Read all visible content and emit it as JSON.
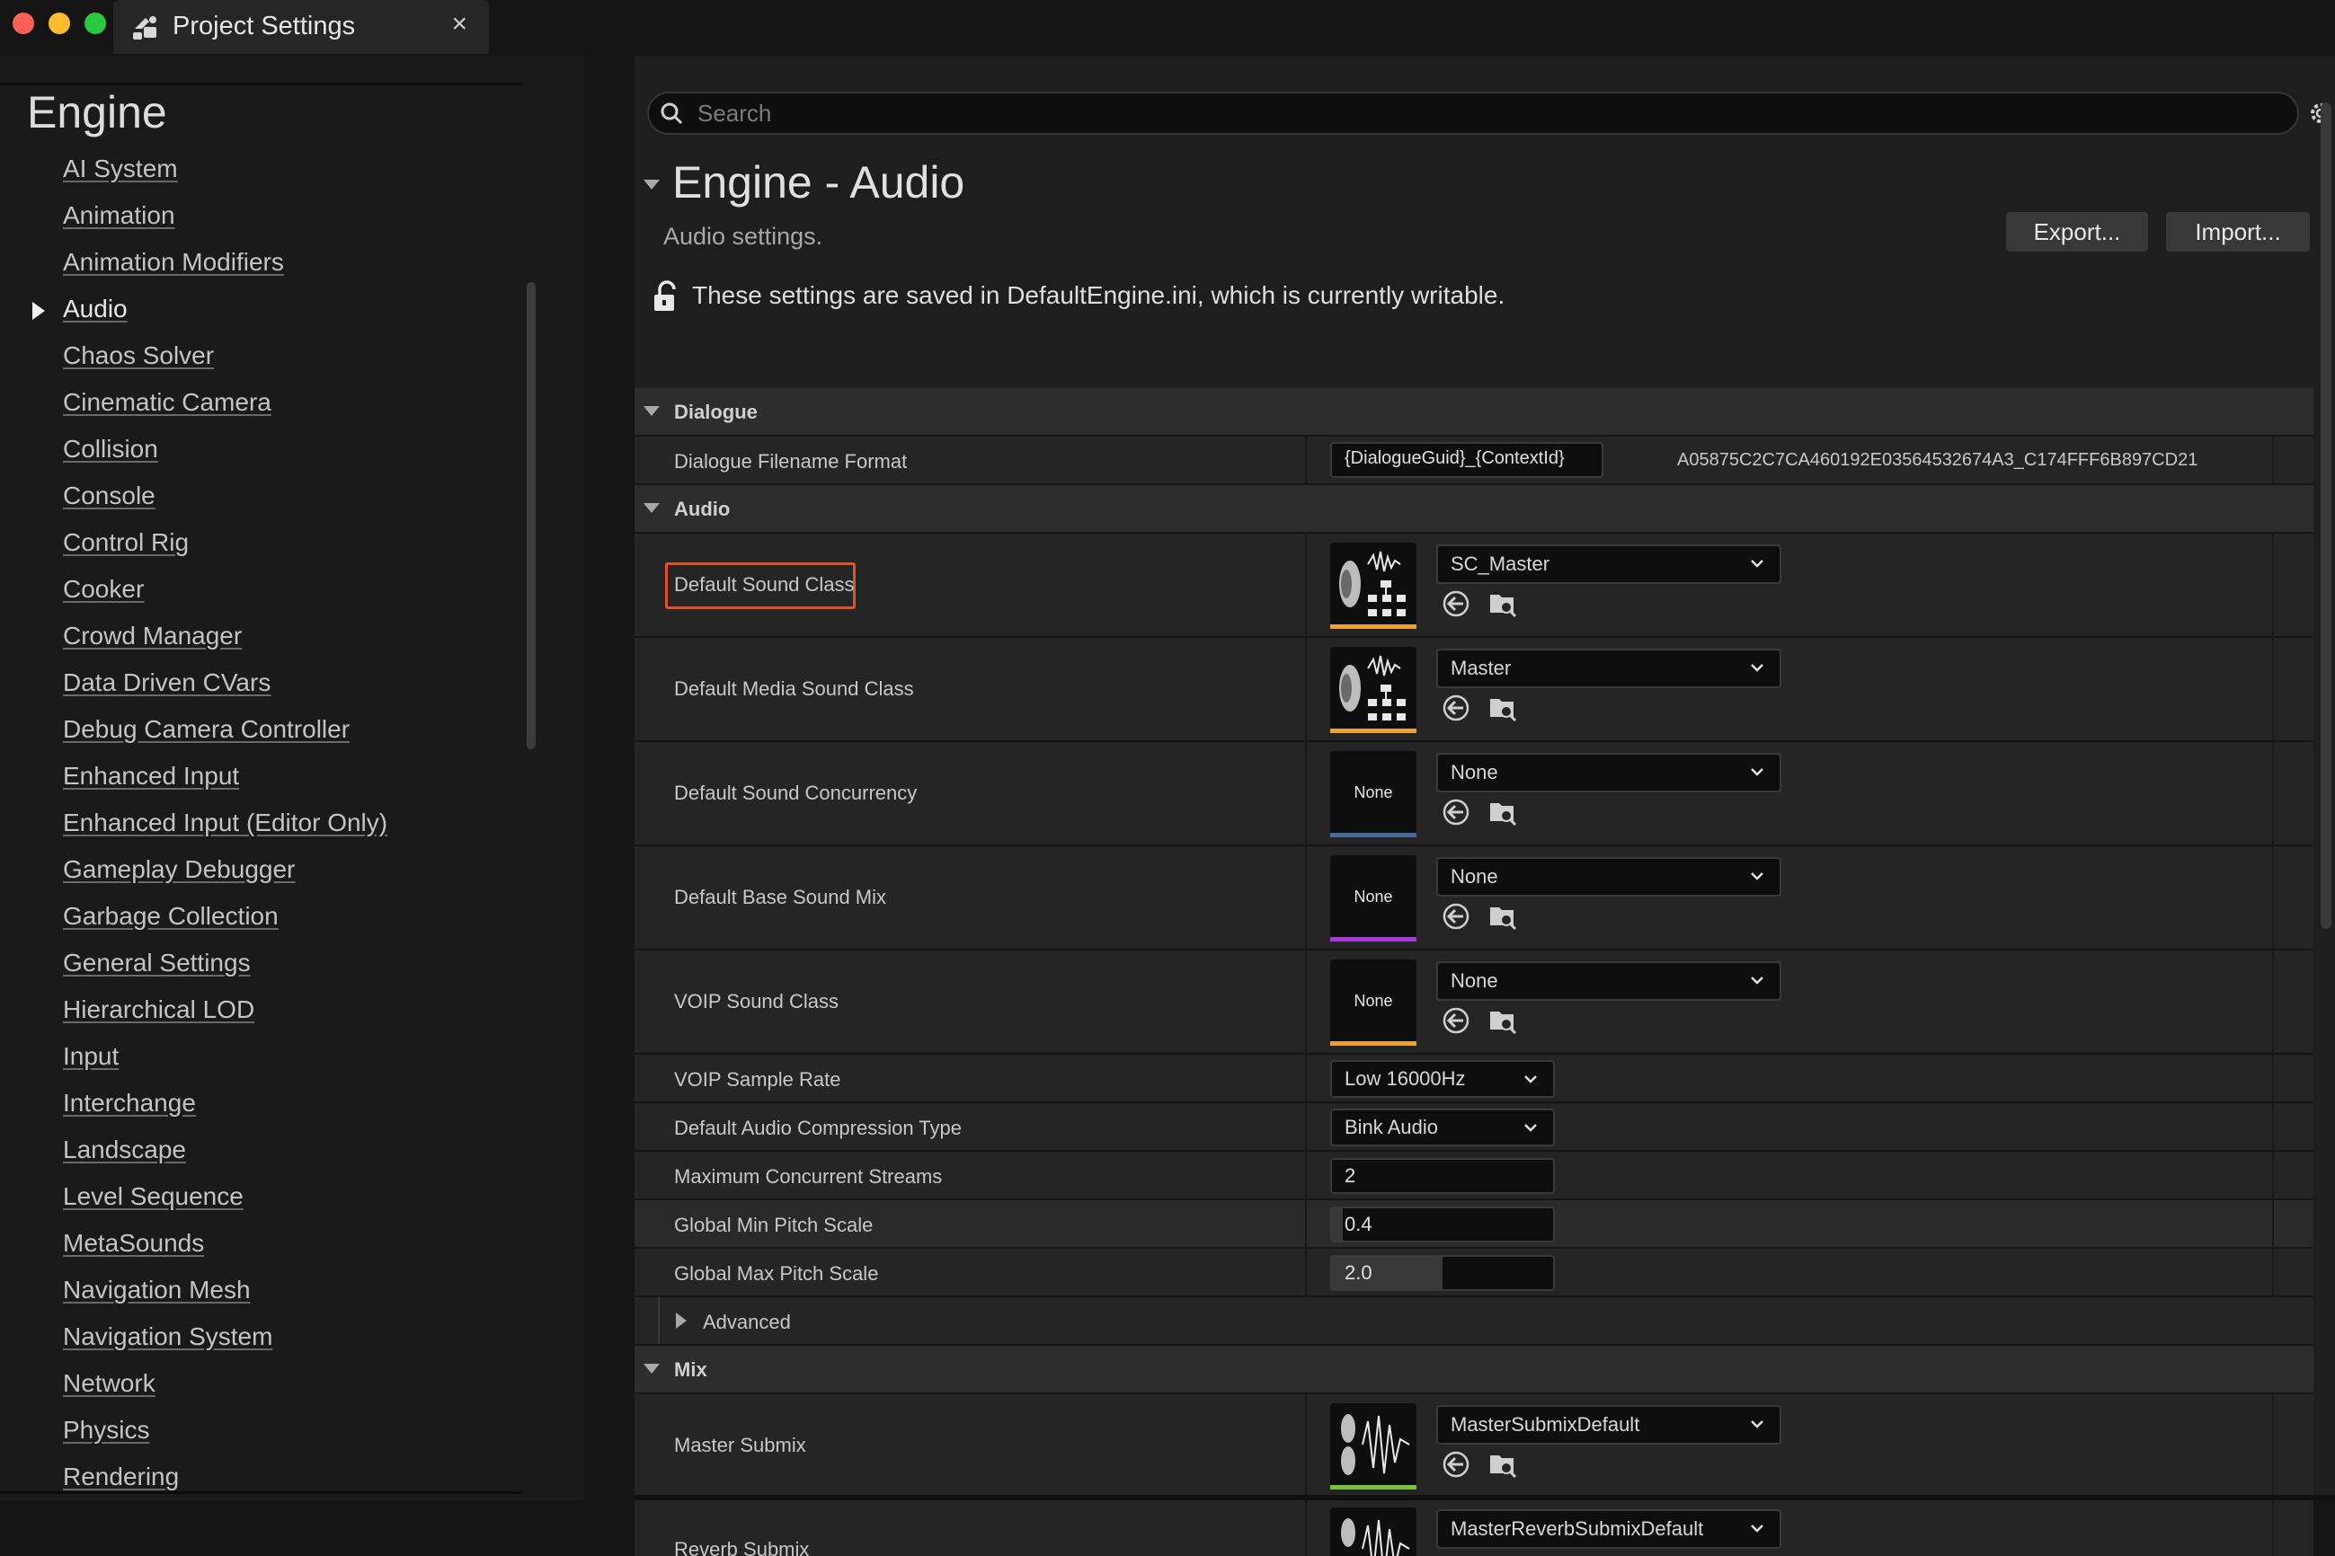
{
  "window": {
    "tab_title": "Project Settings",
    "close_glyph": "×",
    "colors": {
      "close": "#fe5f57",
      "minimize": "#febc2e",
      "maximize": "#28c840"
    }
  },
  "sidebar": {
    "title": "Engine",
    "items": [
      {
        "label": "AI System"
      },
      {
        "label": "Animation"
      },
      {
        "label": "Animation Modifiers"
      },
      {
        "label": "Audio",
        "selected": true
      },
      {
        "label": "Chaos Solver"
      },
      {
        "label": "Cinematic Camera"
      },
      {
        "label": "Collision"
      },
      {
        "label": "Console"
      },
      {
        "label": "Control Rig"
      },
      {
        "label": "Cooker"
      },
      {
        "label": "Crowd Manager"
      },
      {
        "label": "Data Driven CVars"
      },
      {
        "label": "Debug Camera Controller"
      },
      {
        "label": "Enhanced Input"
      },
      {
        "label": "Enhanced Input (Editor Only)"
      },
      {
        "label": "Gameplay Debugger"
      },
      {
        "label": "Garbage Collection"
      },
      {
        "label": "General Settings"
      },
      {
        "label": "Hierarchical LOD"
      },
      {
        "label": "Input"
      },
      {
        "label": "Interchange"
      },
      {
        "label": "Landscape"
      },
      {
        "label": "Level Sequence"
      },
      {
        "label": "MetaSounds"
      },
      {
        "label": "Navigation Mesh"
      },
      {
        "label": "Navigation System"
      },
      {
        "label": "Network"
      },
      {
        "label": "Physics"
      },
      {
        "label": "Rendering"
      }
    ]
  },
  "search": {
    "placeholder": "Search"
  },
  "page": {
    "title": "Engine - Audio",
    "subtitle": "Audio settings.",
    "export_label": "Export...",
    "import_label": "Import...",
    "saved_note": "These settings are saved in DefaultEngine.ini, which is currently writable."
  },
  "sections": {
    "dialogue": {
      "label": "Dialogue",
      "filename_format_label": "Dialogue Filename Format",
      "filename_format_value": "{DialogueGuid}_{ContextId}",
      "guid": "A05875C2C7CA460192E03564532674A3_C174FFF6B897CD21"
    },
    "audio": {
      "label": "Audio",
      "default_sound_class": {
        "label": "Default Sound Class",
        "value": "SC_Master",
        "thumb_color": "#e8a530"
      },
      "default_media_sound_class": {
        "label": "Default Media Sound Class",
        "value": "Master",
        "thumb_color": "#e8a530"
      },
      "default_sound_concurrency": {
        "label": "Default Sound Concurrency",
        "value": "None",
        "thumb_text": "None",
        "thumb_color": "#4a6a9a"
      },
      "default_base_sound_mix": {
        "label": "Default Base Sound Mix",
        "value": "None",
        "thumb_text": "None",
        "thumb_color": "#a83ad8"
      },
      "voip_sound_class": {
        "label": "VOIP Sound Class",
        "value": "None",
        "thumb_text": "None",
        "thumb_color": "#e8a530"
      },
      "voip_sample_rate": {
        "label": "VOIP Sample Rate",
        "value": "Low 16000Hz"
      },
      "compression_type": {
        "label": "Default Audio Compression Type",
        "value": "Bink Audio"
      },
      "max_streams": {
        "label": "Maximum Concurrent Streams",
        "value": "2"
      },
      "min_pitch": {
        "label": "Global Min Pitch Scale",
        "value": "0.4",
        "fill_fraction": 0.05
      },
      "max_pitch": {
        "label": "Global Max Pitch Scale",
        "value": "2.0",
        "fill_fraction": 0.5
      },
      "advanced_label": "Advanced"
    },
    "mix": {
      "label": "Mix",
      "master_submix": {
        "label": "Master Submix",
        "value": "MasterSubmixDefault",
        "thumb_color": "#7ac23a"
      },
      "reverb_submix": {
        "label": "Reverb Submix",
        "value": "MasterReverbSubmixDefault"
      }
    }
  },
  "icons": {
    "app": "unreal-settings-icon",
    "search": "search-icon",
    "settings": "gear-icon",
    "lock": "unlocked-icon",
    "reset": "reset-arrow-icon",
    "browse": "browse-asset-icon",
    "chevron": "chevron-down-icon"
  }
}
